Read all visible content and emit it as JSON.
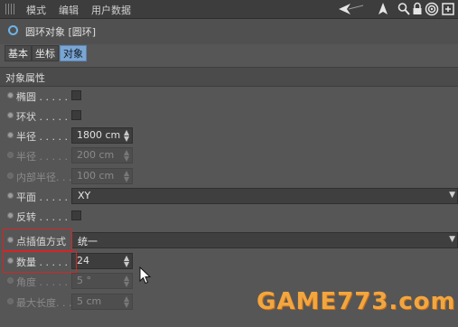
{
  "menu": {
    "items": [
      "模式",
      "编辑",
      "用户数据"
    ]
  },
  "object": {
    "title": "圆环对象 [圆环]"
  },
  "tabs": [
    {
      "label": "基本",
      "active": false
    },
    {
      "label": "坐标",
      "active": false
    },
    {
      "label": "对象",
      "active": true
    }
  ],
  "section": {
    "title": "对象属性"
  },
  "props": {
    "ellipse": {
      "label": "椭圆 . . . . . ."
    },
    "ring": {
      "label": "环状 . . . . . ."
    },
    "radius": {
      "label": "半径 . . . . . .",
      "value": "1800 cm"
    },
    "radius2": {
      "label": "半径 . . . . . .",
      "value": "200 cm"
    },
    "inner_radius": {
      "label": "内部半径. . .",
      "value": "100 cm"
    },
    "plane": {
      "label": "平面 . . . . . .",
      "value": "XY"
    },
    "reverse": {
      "label": "反转 . . . . . ."
    },
    "interpolation": {
      "label": "点插值方式",
      "value": "统一"
    },
    "count": {
      "label": "数量 . . . . . .",
      "value": "24"
    },
    "angle": {
      "label": "角度 . . . . . .",
      "value": "5 °"
    },
    "max_length": {
      "label": "最大长度. . .",
      "value": "5 cm"
    }
  },
  "watermark": {
    "text": "GAME773.com"
  },
  "colors": {
    "highlight": "#d42525",
    "active_tab": "#7aa6d4",
    "watermark": "#f2a640"
  }
}
